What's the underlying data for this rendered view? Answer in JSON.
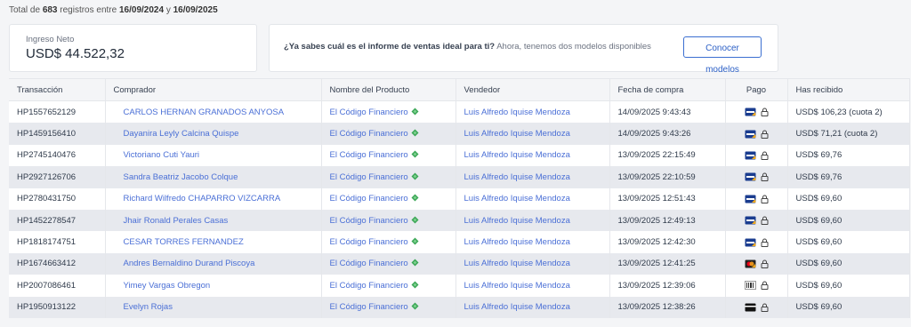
{
  "summary": {
    "prefix": "Total de ",
    "count": "683",
    "middle": " registros entre ",
    "date_from": "16/09/2024",
    "connector": " y ",
    "date_to": "16/09/2025"
  },
  "income": {
    "label": "Ingreso Neto",
    "value": "USD$ 44.522,32"
  },
  "promo": {
    "question": "¿Ya sabes cuál es el informe de ventas ideal para ti?",
    "text": " Ahora, tenemos dos modelos disponibles",
    "button_label": "Conocer modelos"
  },
  "table": {
    "headers": [
      "Transacción",
      "Comprador",
      "Nombre del Producto",
      "Vendedor",
      "Fecha de compra",
      "Pago",
      "Has recibido"
    ],
    "rows": [
      {
        "transaction": "HP1557652129",
        "buyer": "CARLOS HERNAN GRANADOS ANYOSA",
        "product": "El Código Financiero",
        "seller": "Luis Alfredo Iquise Mendoza",
        "date": "14/09/2025 9:43:43",
        "payment_icon": "visa-card-icon",
        "received": "USD$ 106,23  (cuota 2)"
      },
      {
        "transaction": "HP1459156410",
        "buyer": "Dayanira Leyly Calcina Quispe",
        "product": "El Código Financiero",
        "seller": "Luis Alfredo Iquise Mendoza",
        "date": "14/09/2025 9:43:26",
        "payment_icon": "visa-card-icon",
        "received": "USD$ 71,21  (cuota 2)"
      },
      {
        "transaction": "HP2745140476",
        "buyer": "Victoriano Cuti Yauri",
        "product": "El Código Financiero",
        "seller": "Luis Alfredo Iquise Mendoza",
        "date": "13/09/2025 22:15:49",
        "payment_icon": "visa-card-icon",
        "received": "USD$ 69,76"
      },
      {
        "transaction": "HP2927126706",
        "buyer": "Sandra Beatriz Jacobo Colque",
        "product": "El Código Financiero",
        "seller": "Luis Alfredo Iquise Mendoza",
        "date": "13/09/2025 22:10:59",
        "payment_icon": "visa-card-icon",
        "received": "USD$ 69,76"
      },
      {
        "transaction": "HP2780431750",
        "buyer": "Richard Wilfredo CHAPARRO VIZCARRA",
        "product": "El Código Financiero",
        "seller": "Luis Alfredo Iquise Mendoza",
        "date": "13/09/2025 12:51:43",
        "payment_icon": "visa-card-icon",
        "received": "USD$ 69,60"
      },
      {
        "transaction": "HP1452278547",
        "buyer": "Jhair Ronald Perales Casas",
        "product": "El Código Financiero",
        "seller": "Luis Alfredo Iquise Mendoza",
        "date": "13/09/2025 12:49:13",
        "payment_icon": "visa-card-icon",
        "received": "USD$ 69,60"
      },
      {
        "transaction": "HP1818174751",
        "buyer": "CESAR TORRES FERNANDEZ",
        "product": "El Código Financiero",
        "seller": "Luis Alfredo Iquise Mendoza",
        "date": "13/09/2025 12:42:30",
        "payment_icon": "visa-card-icon",
        "received": "USD$ 69,60"
      },
      {
        "transaction": "HP1674663412",
        "buyer": "Andres Bernaldino Durand Piscoya",
        "product": "El Código Financiero",
        "seller": "Luis Alfredo Iquise Mendoza",
        "date": "13/09/2025 12:41:25",
        "payment_icon": "mastercard-icon",
        "received": "USD$ 69,60"
      },
      {
        "transaction": "HP2007086461",
        "buyer": "Yimey Vargas Obregon",
        "product": "El Código Financiero",
        "seller": "Luis Alfredo Iquise Mendoza",
        "date": "13/09/2025 12:39:06",
        "payment_icon": "barcode-ticket-icon",
        "received": "USD$ 69,60"
      },
      {
        "transaction": "HP1950913122",
        "buyer": "Evelyn Rojas",
        "product": "El Código Financiero",
        "seller": "Luis Alfredo Iquise Mendoza",
        "date": "13/09/2025 12:38:26",
        "payment_icon": "black-card-icon",
        "received": "USD$ 69,60"
      }
    ]
  },
  "colors": {
    "link": "#4a6fd6",
    "button": "#2b5fc6",
    "row_alt": "#e7e9ee",
    "product_icon": "#3aa655"
  }
}
